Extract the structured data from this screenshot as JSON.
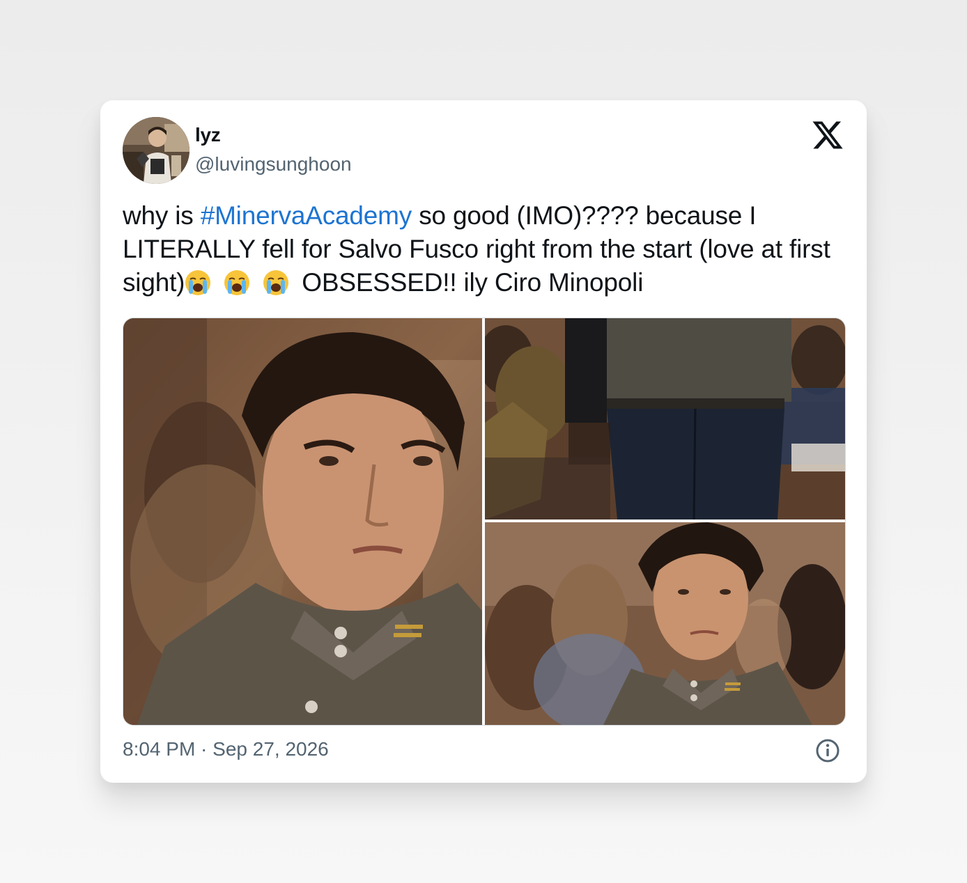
{
  "tweet": {
    "author": {
      "display_name": "lyz",
      "handle": "@luvingsunghoon",
      "avatar_icon": "profile-photo"
    },
    "brand_icon": "x-logo-icon",
    "text": {
      "prefix": "why is ",
      "hashtag": "#MinervaAcademy",
      "middle": " so good (IMO)???? because I LITERALLY fell for Salvo Fusco right from the start (love at first sight)",
      "emojis": [
        "😭",
        "😭",
        "😭"
      ],
      "suffix": "OBSESSED!! ily Ciro Minopoli"
    },
    "media": [
      {
        "icon": "photo-closeup-portrait"
      },
      {
        "icon": "photo-classroom-walking"
      },
      {
        "icon": "photo-classroom-portrait"
      }
    ],
    "timestamp": "8:04 PM · Sep 27, 2026",
    "info_icon": "info-icon"
  },
  "colors": {
    "text": "#0f1419",
    "secondary": "#536471",
    "link": "#1d74d1",
    "card": "#ffffff",
    "background": "#efefef"
  }
}
